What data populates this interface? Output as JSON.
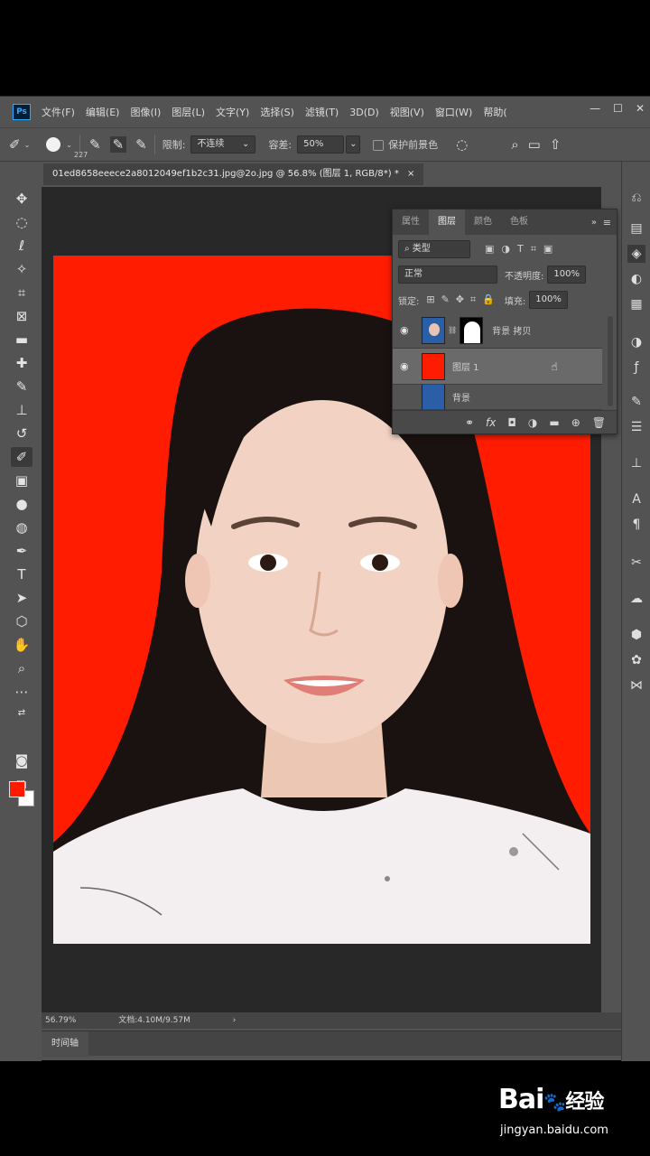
{
  "menubar": {
    "logo": "Ps",
    "items": [
      "文件(F)",
      "编辑(E)",
      "图像(I)",
      "图层(L)",
      "文字(Y)",
      "选择(S)",
      "滤镜(T)",
      "3D(D)",
      "视图(V)",
      "窗口(W)",
      "帮助("
    ],
    "window_controls": [
      "—",
      "☐",
      "✕"
    ]
  },
  "options": {
    "brush_size": "227",
    "limit_label": "限制:",
    "limit_value": "不连续",
    "tolerance_label": "容差:",
    "tolerance_value": "50%",
    "protect_fg_label": "保护前景色"
  },
  "document": {
    "tab_title": "01ed8658eeece2a8012049ef1b2c31.jpg@2o.jpg @ 56.8% (图层 1, RGB/8*) *",
    "close": "×"
  },
  "status": {
    "zoom": "56.79%",
    "doc_size": "文档:4.10M/9.57M",
    "arrow": "›"
  },
  "timeline": {
    "label": "时间轴"
  },
  "layers_panel": {
    "tabs": [
      "属性",
      "图层",
      "颜色",
      "色板"
    ],
    "active_tab": "图层",
    "filter_label": "类型",
    "blend_mode": "正常",
    "opacity_label": "不透明度:",
    "opacity_value": "100%",
    "lock_label": "锁定:",
    "fill_label": "填充:",
    "fill_value": "100%",
    "layers": [
      {
        "name": "背景 拷贝",
        "visible": true,
        "has_mask": true
      },
      {
        "name": "图层 1",
        "visible": true,
        "color": "#ff1c00"
      },
      {
        "name": "背景",
        "visible": false
      }
    ],
    "bottom_icons": [
      "link-icon",
      "fx-icon",
      "mask-icon",
      "adjustment-icon",
      "folder-icon",
      "new-layer-icon",
      "trash-icon"
    ]
  },
  "colors": {
    "foreground": "#ff1a00",
    "background": "#ffffff",
    "photo_bg": "#ff1c00"
  },
  "watermark": {
    "logo": "Bai",
    "logo_cn": "经验",
    "url": "jingyan.baidu.com"
  }
}
